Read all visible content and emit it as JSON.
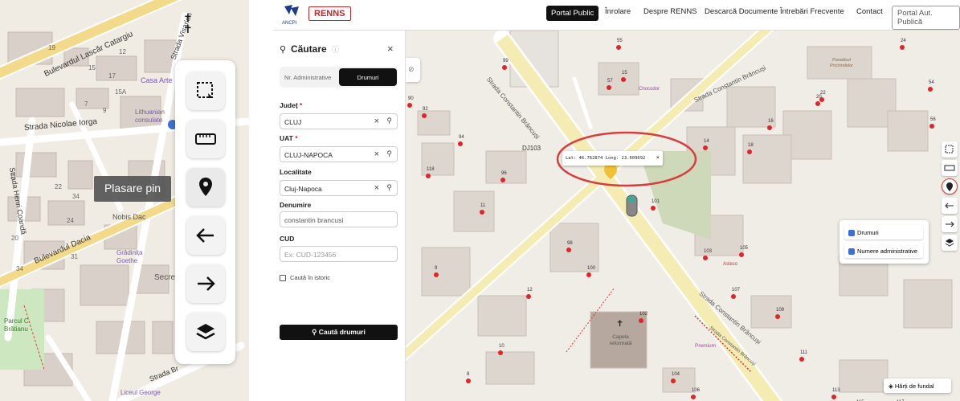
{
  "left_map": {
    "street_lascar": "Bulevardul Lascăr Catargiu",
    "street_iorga": "Strada Nicolae Iorga",
    "street_coanda": "Strada Henri Coandă",
    "street_dacia": "Bulevardul Dacia",
    "street_viseor": "Strada Visarion",
    "street_brancusi_small": "Strada Br",
    "poi_casa": "Casa Arte",
    "poi_lithuanian": "Lithuanian consulate",
    "poi_nobis": "Nobis Dac",
    "poi_gradinita": "Grădinița Goethe",
    "poi_secre": "Secre",
    "poi_parcul": "Parcul C. Brătianu",
    "poi_liceul": "Liceul George",
    "numbers": [
      "19",
      "12",
      "15",
      "17",
      "15A",
      "7",
      "9",
      "11",
      "22",
      "34",
      "20",
      "24",
      "31",
      "34"
    ],
    "tooltip": "Plasare pin"
  },
  "left_toolbar": [
    {
      "name": "select-area-icon",
      "label": "select"
    },
    {
      "name": "ruler-icon",
      "label": "measure"
    },
    {
      "name": "pin-icon",
      "label": "pin"
    },
    {
      "name": "arrow-left-icon",
      "label": "back"
    },
    {
      "name": "arrow-right-icon",
      "label": "forward"
    },
    {
      "name": "layers-icon",
      "label": "layers"
    }
  ],
  "header": {
    "logo_ancpi": "ANCPI",
    "logo_renns": "RENNS",
    "nav": [
      "Portal Public",
      "Înrolare",
      "Despre RENNS",
      "Descarcă Documente",
      "Întrebări Frecvente",
      "Contact",
      "Portal Aut. Publică"
    ]
  },
  "search_panel": {
    "title": "Căutare",
    "tabs": [
      "Nr. Administrative",
      "Drumuri"
    ],
    "judet_label": "Județ",
    "judet_value": "CLUJ",
    "uat_label": "UAT",
    "uat_value": "CLUJ-NAPOCA",
    "localitate_label": "Localitate",
    "localitate_value": "Cluj-Napoca",
    "denumire_label": "Denumire",
    "denumire_value": "constantin brancusi",
    "cud_label": "CUD",
    "cud_placeholder": "Ex: CUD-123456",
    "istoric_label": "Caută în istoric",
    "search_button": "Caută drumuri"
  },
  "map": {
    "coords": "Lat: 46.762874 Long: 23.609692",
    "road_label_1": "Strada Constantin Brâncuși",
    "road_label_2": "Strada Constantin Brâncuși",
    "road_label_3": "Strada Constantin Brâncuși",
    "road_label_4": "Strada Constantin Brâncuși",
    "road_code": "DJ103",
    "poi_chocodor": "Chocodor",
    "poi_asleco": "Asleco",
    "poi_capela": "Capela reformată",
    "poi_premium": "Premium",
    "poi_paradisul": "Paradisul Prichindelor",
    "house_numbers": [
      "55",
      "99",
      "57",
      "15",
      "92",
      "90",
      "94",
      "118",
      "96",
      "11",
      "14",
      "18",
      "16",
      "22",
      "20",
      "24",
      "54",
      "56",
      "101",
      "103",
      "98",
      "9",
      "100",
      "105",
      "12",
      "107",
      "109",
      "10",
      "102",
      "8",
      "104",
      "106",
      "108",
      "111",
      "113",
      "115",
      "117"
    ],
    "layers": {
      "drumuri": "Drumuri",
      "numere": "Numere administrative"
    },
    "basemap_button": "Hărți de fundal"
  },
  "colors": {
    "accent_red": "#c0282d",
    "pin_yellow": "#f2c037",
    "check_blue": "#3a6fd8"
  }
}
